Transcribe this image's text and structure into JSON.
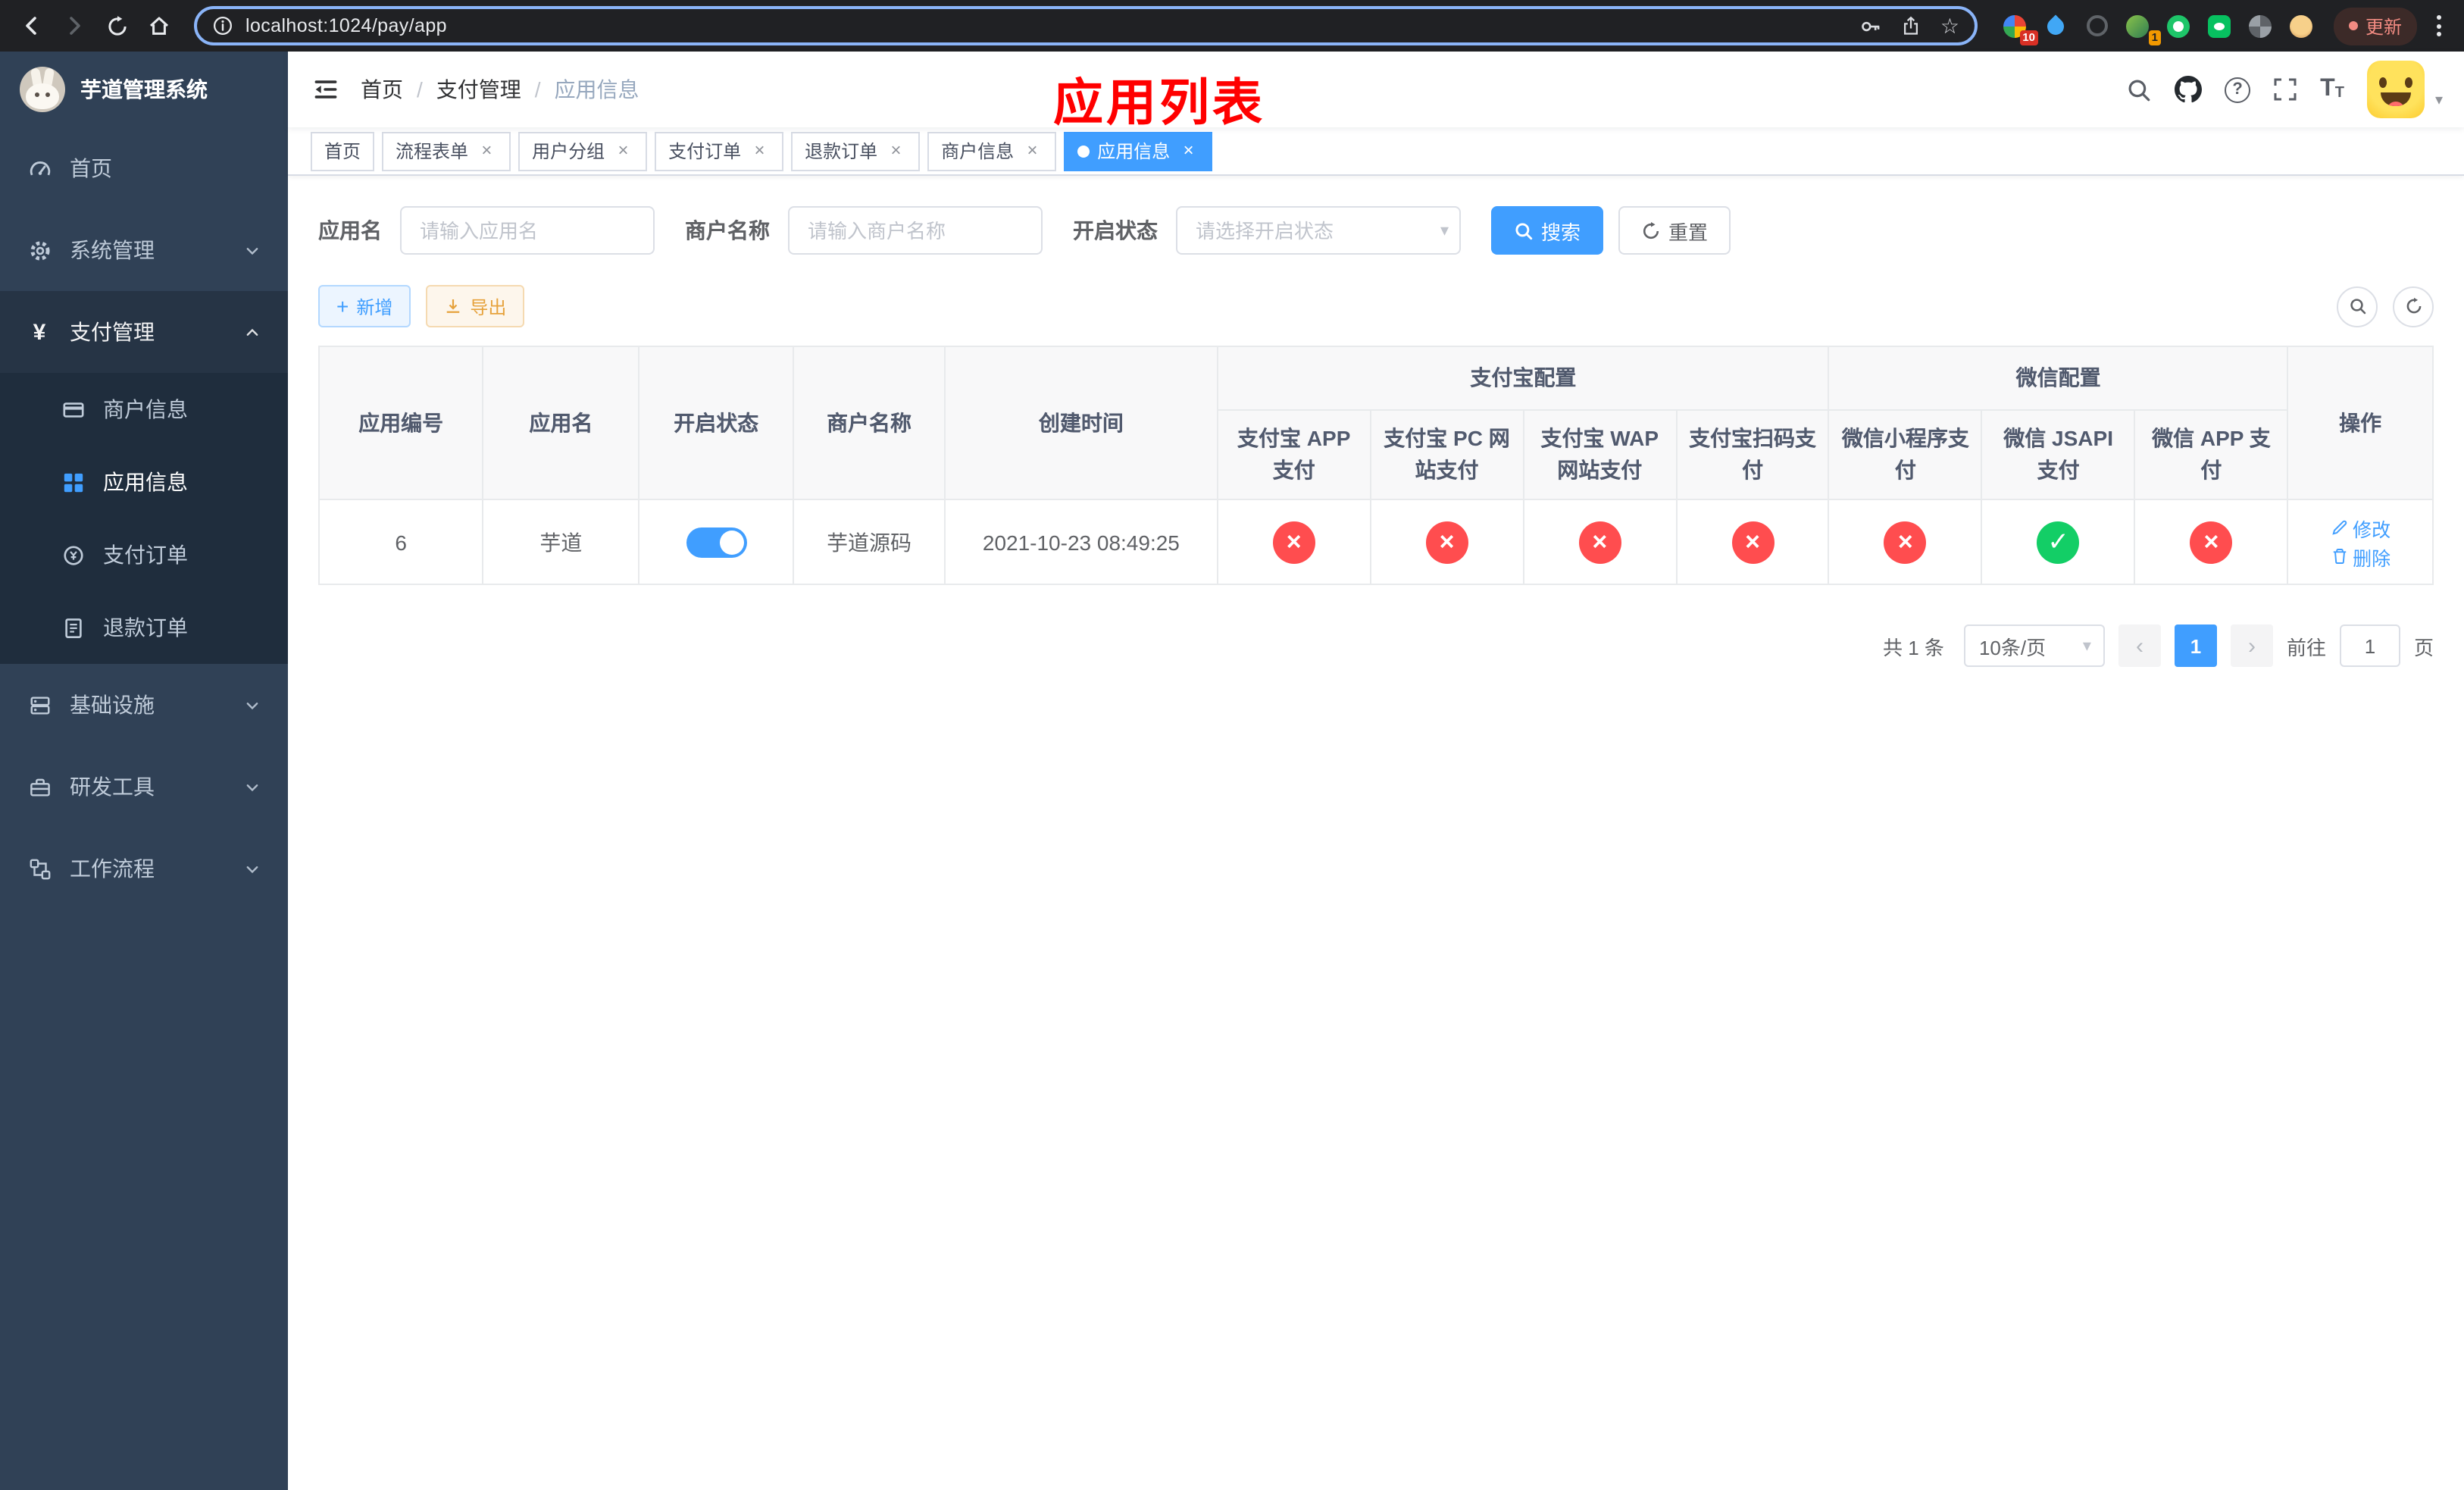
{
  "colors": {
    "accent": "#409eff",
    "danger": "#ff4d4f",
    "success": "#13ce66",
    "warning": "#e6a23c",
    "sidebar_bg": "#304156",
    "annotation": "#ff0000"
  },
  "browser": {
    "url": "localhost:1024/pay/app",
    "update_label": "更新",
    "extension_badges": {
      "first": "10",
      "fourth": "1"
    }
  },
  "sidebar": {
    "title": "芋道管理系统",
    "menu": [
      {
        "label": "首页"
      },
      {
        "label": "系统管理"
      },
      {
        "label": "支付管理"
      },
      {
        "label": "基础设施"
      },
      {
        "label": "研发工具"
      },
      {
        "label": "工作流程"
      }
    ],
    "submenu": [
      {
        "label": "商户信息"
      },
      {
        "label": "应用信息"
      },
      {
        "label": "支付订单"
      },
      {
        "label": "退款订单"
      }
    ]
  },
  "navbar": {
    "breadcrumb": [
      "首页",
      "支付管理",
      "应用信息"
    ],
    "separator": "/",
    "annotation": "应用列表"
  },
  "tabs": [
    {
      "label": "首页"
    },
    {
      "label": "流程表单"
    },
    {
      "label": "用户分组"
    },
    {
      "label": "支付订单"
    },
    {
      "label": "退款订单"
    },
    {
      "label": "商户信息"
    },
    {
      "label": "应用信息"
    }
  ],
  "filters": {
    "app_name_label": "应用名",
    "app_name_placeholder": "请输入应用名",
    "merchant_label": "商户名称",
    "merchant_placeholder": "请输入商户名称",
    "status_label": "开启状态",
    "status_placeholder": "请选择开启状态",
    "search_label": "搜索",
    "reset_label": "重置"
  },
  "toolbar": {
    "add_label": "新增",
    "export_label": "导出"
  },
  "table": {
    "columns": [
      "应用编号",
      "应用名",
      "开启状态",
      "商户名称",
      "创建时间"
    ],
    "groups": [
      "支付宝配置",
      "微信配置"
    ],
    "alipay_columns": [
      "支付宝 APP 支付",
      "支付宝 PC 网站支付",
      "支付宝 WAP 网站支付",
      "支付宝扫码支付"
    ],
    "wechat_columns": [
      "微信小程序支付",
      "微信 JSAPI 支付",
      "微信 APP 支付"
    ],
    "action_header": "操作",
    "row": {
      "id": "6",
      "name": "芋道",
      "status": "on",
      "merchant": "芋道源码",
      "created": "2021-10-23 08:49:25",
      "channels": [
        "off",
        "off",
        "off",
        "off",
        "off",
        "on",
        "off"
      ],
      "edit_label": "修改",
      "delete_label": "删除"
    }
  },
  "pagination": {
    "total": "共 1 条",
    "page_size": "10条/页",
    "current": "1",
    "prev": "‹",
    "next": "›",
    "goto_label": "前往",
    "goto_value": "1",
    "page_suffix": "页"
  },
  "icons": {
    "close": "×",
    "cross": "×",
    "check": "✓",
    "caret": "▾",
    "star": "☆",
    "plus": "+",
    "question": "?",
    "yen": "¥",
    "t_large": "T",
    "t_small": "T"
  }
}
